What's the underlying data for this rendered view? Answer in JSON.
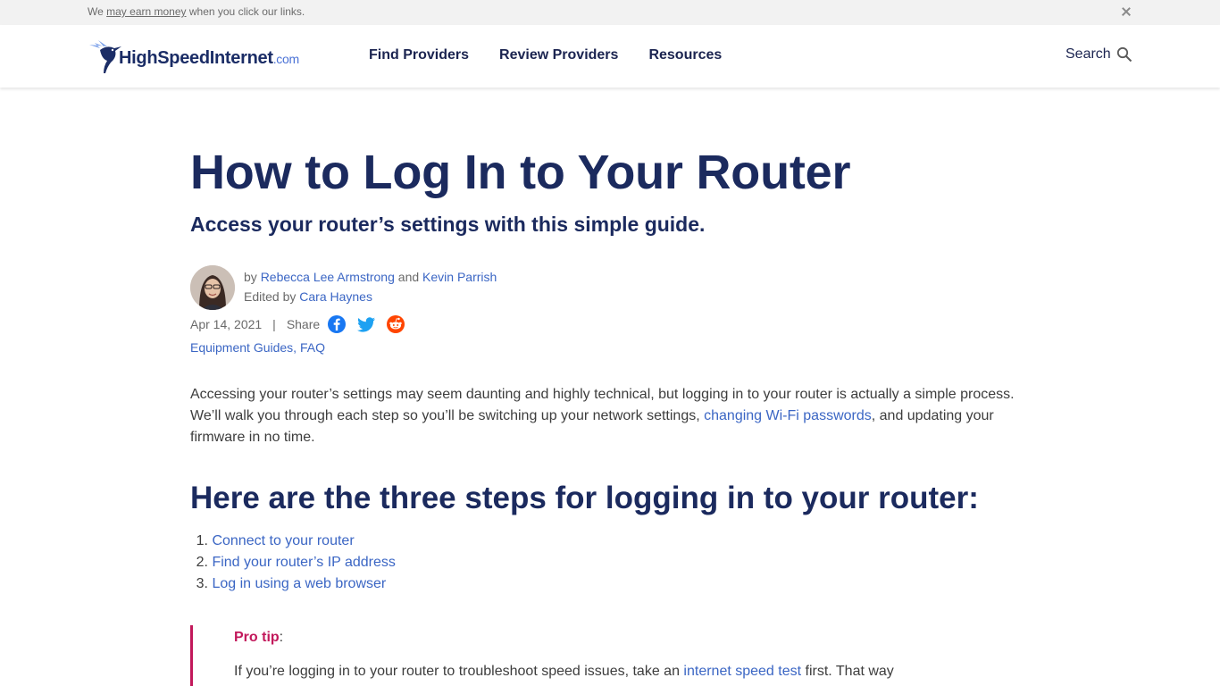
{
  "disclosure": {
    "prefix": "We",
    "link": "may earn money",
    "suffix": "when you click our links."
  },
  "header": {
    "logo_main": "HighSpeedInternet",
    "logo_tld": ".com",
    "nav": [
      "Find Providers",
      "Review Providers",
      "Resources"
    ],
    "search_label": "Search"
  },
  "article": {
    "title": "How to Log In to Your Router",
    "subtitle": "Access your router’s settings with this simple guide.",
    "by_prefix": "by",
    "author1": "Rebecca Lee Armstrong",
    "and": "and",
    "author2": "Kevin Parrish",
    "edited_prefix": "Edited by",
    "editor": "Cara Haynes",
    "date": "Apr 14, 2021",
    "separator": "|",
    "share_label": "Share",
    "categories": "Equipment Guides, FAQ",
    "intro_part1": "Accessing your router’s settings may seem daunting and highly technical, but logging in to your router is actually a simple process. We’ll walk you through each step so you’ll be switching up your network settings,",
    "intro_link": "changing Wi-Fi passwords",
    "intro_part2": ", and updating your firmware in no time.",
    "steps_heading": "Here are the three steps for logging in to your router:",
    "steps": [
      {
        "num": "1.",
        "label": "Connect to your router"
      },
      {
        "num": "2.",
        "label": "Find your router’s IP address"
      },
      {
        "num": "3.",
        "label": "Log in using a web browser"
      }
    ],
    "protip_label": "Pro tip",
    "protip_colon": ":",
    "protip_prefix": "If you’re logging in to your router to troubleshoot speed issues, take an",
    "protip_link": "internet speed test",
    "protip_suffix": "first. That way"
  },
  "colors": {
    "navy": "#1b2a5e",
    "link": "#3b66c4",
    "accent": "#c2185b",
    "facebook": "#1877f2",
    "twitter": "#1da1f2",
    "reddit": "#ff4500"
  },
  "icons": {
    "close": "close-icon",
    "search": "search-icon",
    "facebook": "facebook-icon",
    "twitter": "twitter-icon",
    "reddit": "reddit-icon",
    "logo": "hummingbird-logo-icon"
  }
}
